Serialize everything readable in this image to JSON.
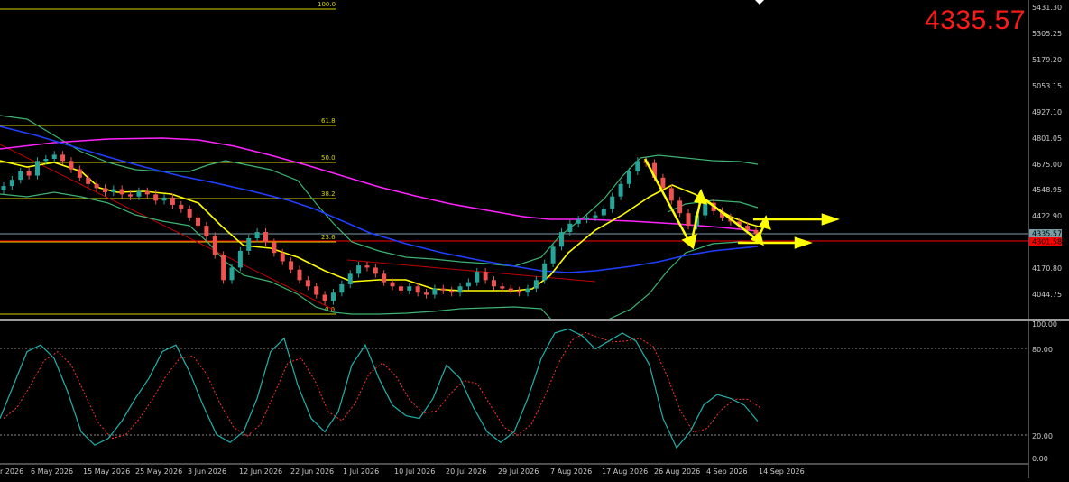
{
  "window": {
    "big_price": "4335.57",
    "colors": {
      "background": "#000000",
      "up_candle": "#26a69a",
      "down_candle": "#ef5350",
      "axis_text": "#c8c8c8",
      "big_price": "#ff1a1a",
      "fib_line": "#d4d400",
      "bollinger": "#3cb371",
      "ma_fast": "#ffff00",
      "ma_mid": "#1f3fff",
      "ma_slow": "#ff22ff",
      "trend_line": "#c00000",
      "arrows": "#ffff00",
      "stoch_main": "#20b2aa",
      "stoch_signal": "#ff3030",
      "bid_line": "#7a9ea8",
      "level_line": "#ff0000"
    }
  },
  "price_axis": {
    "ticks": [
      "5431.30",
      "5305.25",
      "5179.20",
      "5053.15",
      "4927.10",
      "4801.05",
      "4675.00",
      "4548.95",
      "4422.90",
      "4170.80",
      "4044.75"
    ],
    "bid_label": "4335.57",
    "level_label": "4301.58"
  },
  "fibonacci": {
    "levels": [
      "100.0",
      "61.8",
      "50.0",
      "38.2",
      "23.6",
      "0.0"
    ]
  },
  "time_axis": {
    "labels": [
      "r 2026",
      "6 May 2026",
      "15 May 2026",
      "25 May 2026",
      "3 Jun 2026",
      "12 Jun 2026",
      "22 Jun 2026",
      "1 Jul 2026",
      "10 Jul 2026",
      "20 Jul 2026",
      "29 Jul 2026",
      "7 Aug 2026",
      "17 Aug 2026",
      "26 Aug 2026",
      "4 Sep 2026",
      "14 Sep 2026"
    ]
  },
  "stochastic": {
    "ticks": [
      "100.00",
      "80.00",
      "20.00",
      "0.00"
    ]
  },
  "chart_data": {
    "type": "line",
    "price_scale": [
      3940,
      5460
    ],
    "candles_close": [
      4570,
      4600,
      4640,
      4620,
      4690,
      4700,
      4720,
      4690,
      4650,
      4610,
      4580,
      4560,
      4540,
      4555,
      4530,
      4520,
      4545,
      4530,
      4500,
      4515,
      4480,
      4460,
      4420,
      4380,
      4330,
      4240,
      4120,
      4180,
      4260,
      4320,
      4350,
      4300,
      4250,
      4210,
      4170,
      4120,
      4090,
      4050,
      4020,
      4060,
      4100,
      4150,
      4190,
      4180,
      4150,
      4110,
      4090,
      4070,
      4090,
      4060,
      4050,
      4080,
      4070,
      4060,
      4090,
      4110,
      4160,
      4120,
      4090,
      4080,
      4070,
      4060,
      4080,
      4120,
      4200,
      4280,
      4350,
      4390,
      4410,
      4420,
      4430,
      4460,
      4520,
      4580,
      4640,
      4690,
      4680,
      4610,
      4560,
      4500,
      4440,
      4380,
      4430,
      4490,
      4450,
      4420,
      4400,
      4380,
      4360,
      4340
    ],
    "stochastic_k": [
      30,
      55,
      80,
      85,
      75,
      50,
      20,
      10,
      15,
      28,
      45,
      60,
      80,
      85,
      65,
      40,
      18,
      12,
      20,
      45,
      80,
      90,
      55,
      30,
      20,
      35,
      70,
      85,
      60,
      40,
      32,
      30,
      45,
      70,
      60,
      38,
      20,
      12,
      20,
      45,
      75,
      94,
      97,
      92,
      82,
      88,
      94,
      88,
      70,
      30,
      8,
      20,
      40,
      48,
      45,
      40,
      28
    ]
  }
}
